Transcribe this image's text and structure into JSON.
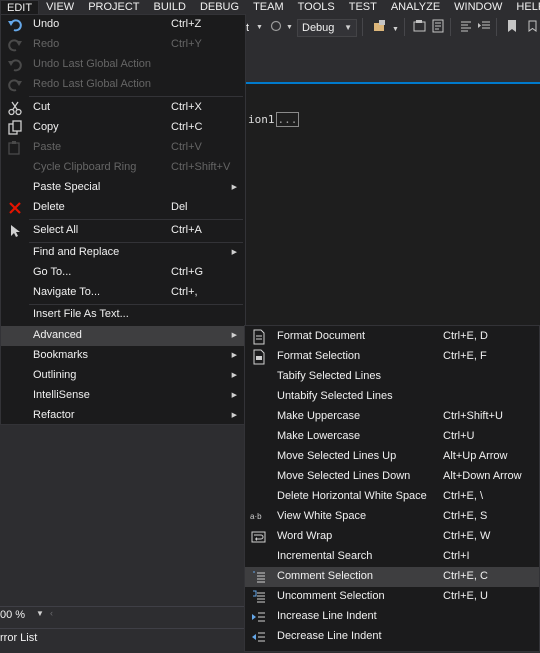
{
  "menubar": {
    "items": [
      "EDIT",
      "VIEW",
      "PROJECT",
      "BUILD",
      "DEBUG",
      "TEAM",
      "TOOLS",
      "TEST",
      "ANALYZE",
      "WINDOW",
      "HELP"
    ]
  },
  "toolbar": {
    "config_value": "Debug",
    "partial_text": "t"
  },
  "editor": {
    "code_text": "ion1",
    "collapsed_text": "..."
  },
  "edit_menu": {
    "items": [
      {
        "label": "Undo",
        "shortcut": "Ctrl+Z",
        "icon": "undo-icon",
        "enabled": true
      },
      {
        "label": "Redo",
        "shortcut": "Ctrl+Y",
        "icon": "redo-icon",
        "enabled": false
      },
      {
        "label": "Undo Last Global Action",
        "shortcut": "",
        "icon": "undo-global-icon",
        "enabled": false
      },
      {
        "label": "Redo Last Global Action",
        "shortcut": "",
        "icon": "redo-global-icon",
        "enabled": false
      },
      {
        "label": "Cut",
        "shortcut": "Ctrl+X",
        "icon": "scissors-icon",
        "enabled": true
      },
      {
        "label": "Copy",
        "shortcut": "Ctrl+C",
        "icon": "copy-icon",
        "enabled": true
      },
      {
        "label": "Paste",
        "shortcut": "Ctrl+V",
        "icon": "paste-icon",
        "enabled": false
      },
      {
        "label": "Cycle Clipboard Ring",
        "shortcut": "Ctrl+Shift+V",
        "icon": "",
        "enabled": false
      },
      {
        "label": "Paste Special",
        "shortcut": "",
        "icon": "",
        "enabled": true,
        "submenu": true
      },
      {
        "label": "Delete",
        "shortcut": "Del",
        "icon": "delete-x-icon",
        "enabled": true
      },
      {
        "label": "Select All",
        "shortcut": "Ctrl+A",
        "icon": "select-all-icon",
        "enabled": true
      },
      {
        "label": "Find and Replace",
        "shortcut": "",
        "icon": "",
        "enabled": true,
        "submenu": true
      },
      {
        "label": "Go To...",
        "shortcut": "Ctrl+G",
        "icon": "",
        "enabled": true
      },
      {
        "label": "Navigate To...",
        "shortcut": "Ctrl+,",
        "icon": "",
        "enabled": true
      },
      {
        "label": "Insert File As Text...",
        "shortcut": "",
        "icon": "",
        "enabled": true
      },
      {
        "label": "Advanced",
        "shortcut": "",
        "icon": "",
        "enabled": true,
        "submenu": true,
        "highlighted": true
      },
      {
        "label": "Bookmarks",
        "shortcut": "",
        "icon": "",
        "enabled": true,
        "submenu": true
      },
      {
        "label": "Outlining",
        "shortcut": "",
        "icon": "",
        "enabled": true,
        "submenu": true
      },
      {
        "label": "IntelliSense",
        "shortcut": "",
        "icon": "",
        "enabled": true,
        "submenu": true
      },
      {
        "label": "Refactor",
        "shortcut": "",
        "icon": "",
        "enabled": true,
        "submenu": true
      }
    ]
  },
  "advanced_menu": {
    "items": [
      {
        "label": "Format Document",
        "shortcut": "Ctrl+E, D",
        "icon": "format-document-icon"
      },
      {
        "label": "Format Selection",
        "shortcut": "Ctrl+E, F",
        "icon": "format-selection-icon"
      },
      {
        "label": "Tabify Selected Lines",
        "shortcut": "",
        "icon": ""
      },
      {
        "label": "Untabify Selected Lines",
        "shortcut": "",
        "icon": ""
      },
      {
        "label": "Make Uppercase",
        "shortcut": "Ctrl+Shift+U",
        "icon": ""
      },
      {
        "label": "Make Lowercase",
        "shortcut": "Ctrl+U",
        "icon": ""
      },
      {
        "label": "Move Selected Lines Up",
        "shortcut": "Alt+Up Arrow",
        "icon": ""
      },
      {
        "label": "Move Selected Lines Down",
        "shortcut": "Alt+Down Arrow",
        "icon": ""
      },
      {
        "label": "Delete Horizontal White Space",
        "shortcut": "Ctrl+E, \\",
        "icon": ""
      },
      {
        "label": "View White Space",
        "shortcut": "Ctrl+E, S",
        "icon": "whitespace-icon",
        "icon_text": "a·b"
      },
      {
        "label": "Word Wrap",
        "shortcut": "Ctrl+E, W",
        "icon": "word-wrap-icon"
      },
      {
        "label": "Incremental Search",
        "shortcut": "Ctrl+I",
        "icon": ""
      },
      {
        "label": "Comment Selection",
        "shortcut": "Ctrl+E, C",
        "icon": "comment-icon",
        "highlighted": true
      },
      {
        "label": "Uncomment Selection",
        "shortcut": "Ctrl+E, U",
        "icon": "uncomment-icon"
      },
      {
        "label": "Increase Line Indent",
        "shortcut": "",
        "icon": "increase-indent-icon"
      },
      {
        "label": "Decrease Line Indent",
        "shortcut": "",
        "icon": "decrease-indent-icon"
      }
    ]
  },
  "statusbar": {
    "zoom": "00 %",
    "error_list_tab": "rror List"
  },
  "colors": {
    "background": "#2d2d30",
    "menu_background": "#1b1b1c",
    "menu_highlight": "#3e3e40",
    "accent": "#007acc",
    "disabled_text": "#656565",
    "delete_icon": "#e51400"
  }
}
